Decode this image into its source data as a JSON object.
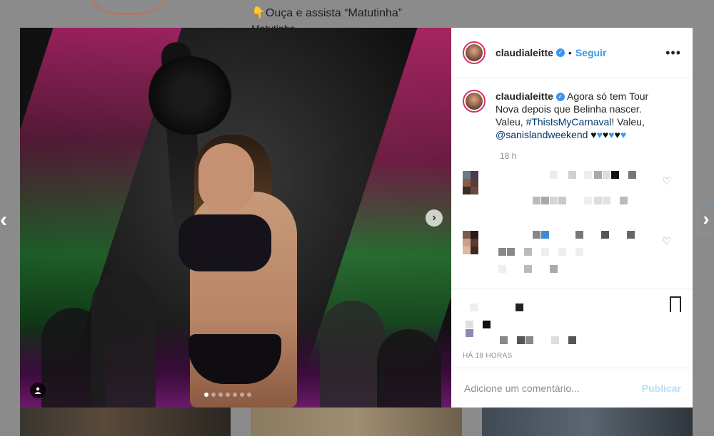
{
  "background": {
    "caption_line1": "👇Ouça e assista “Matutinha”",
    "caption_line2": "Matutinha"
  },
  "post": {
    "username": "claudialeitte",
    "follow_label": "Seguir",
    "separator": "•",
    "more_icon": "•••",
    "caption_prefix": "Agora só tem Tour Nova depois que Belinha nascer. Valeu,",
    "hashtag": "#ThisIsMyCarnaval",
    "caption_mid": "! Valeu,",
    "mention": "@sanislandweekend",
    "hearts": "♥",
    "caption_time": "18 h",
    "timestamp": "HÁ 18 HORAS",
    "comment_placeholder": "Adicione um comentário...",
    "publish_label": "Publicar",
    "carousel_slides": 7,
    "carousel_active": 1
  },
  "colors": {
    "accent": "#3897f0",
    "link": "#00376b",
    "muted": "#8e8e8e",
    "publish_disabled": "#b2dffc"
  }
}
